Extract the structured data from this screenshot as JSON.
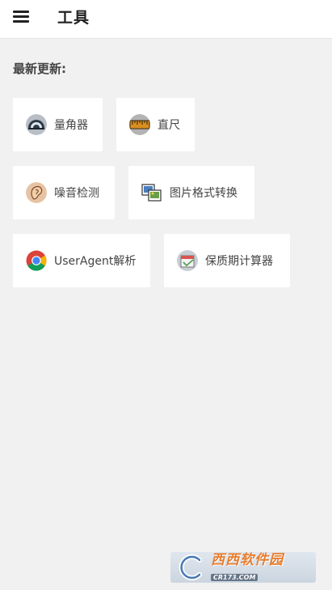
{
  "appbar": {
    "title": "工具"
  },
  "section": {
    "title": "最新更新:"
  },
  "tools": [
    {
      "label": "量角器",
      "icon": "protractor-icon"
    },
    {
      "label": "直尺",
      "icon": "ruler-icon"
    },
    {
      "label": "噪音检测",
      "icon": "ear-icon"
    },
    {
      "label": "图片格式转换",
      "icon": "image-convert-icon"
    },
    {
      "label": "UserAgent解析",
      "icon": "chrome-icon"
    },
    {
      "label": "保质期计算器",
      "icon": "calendar-icon"
    }
  ],
  "watermark": {
    "text": "西西软件园",
    "sub": "CR173.COM"
  },
  "colors": {
    "background": "#f1f1f1",
    "card": "#ffffff",
    "watermark_accent": "#e8731c"
  }
}
